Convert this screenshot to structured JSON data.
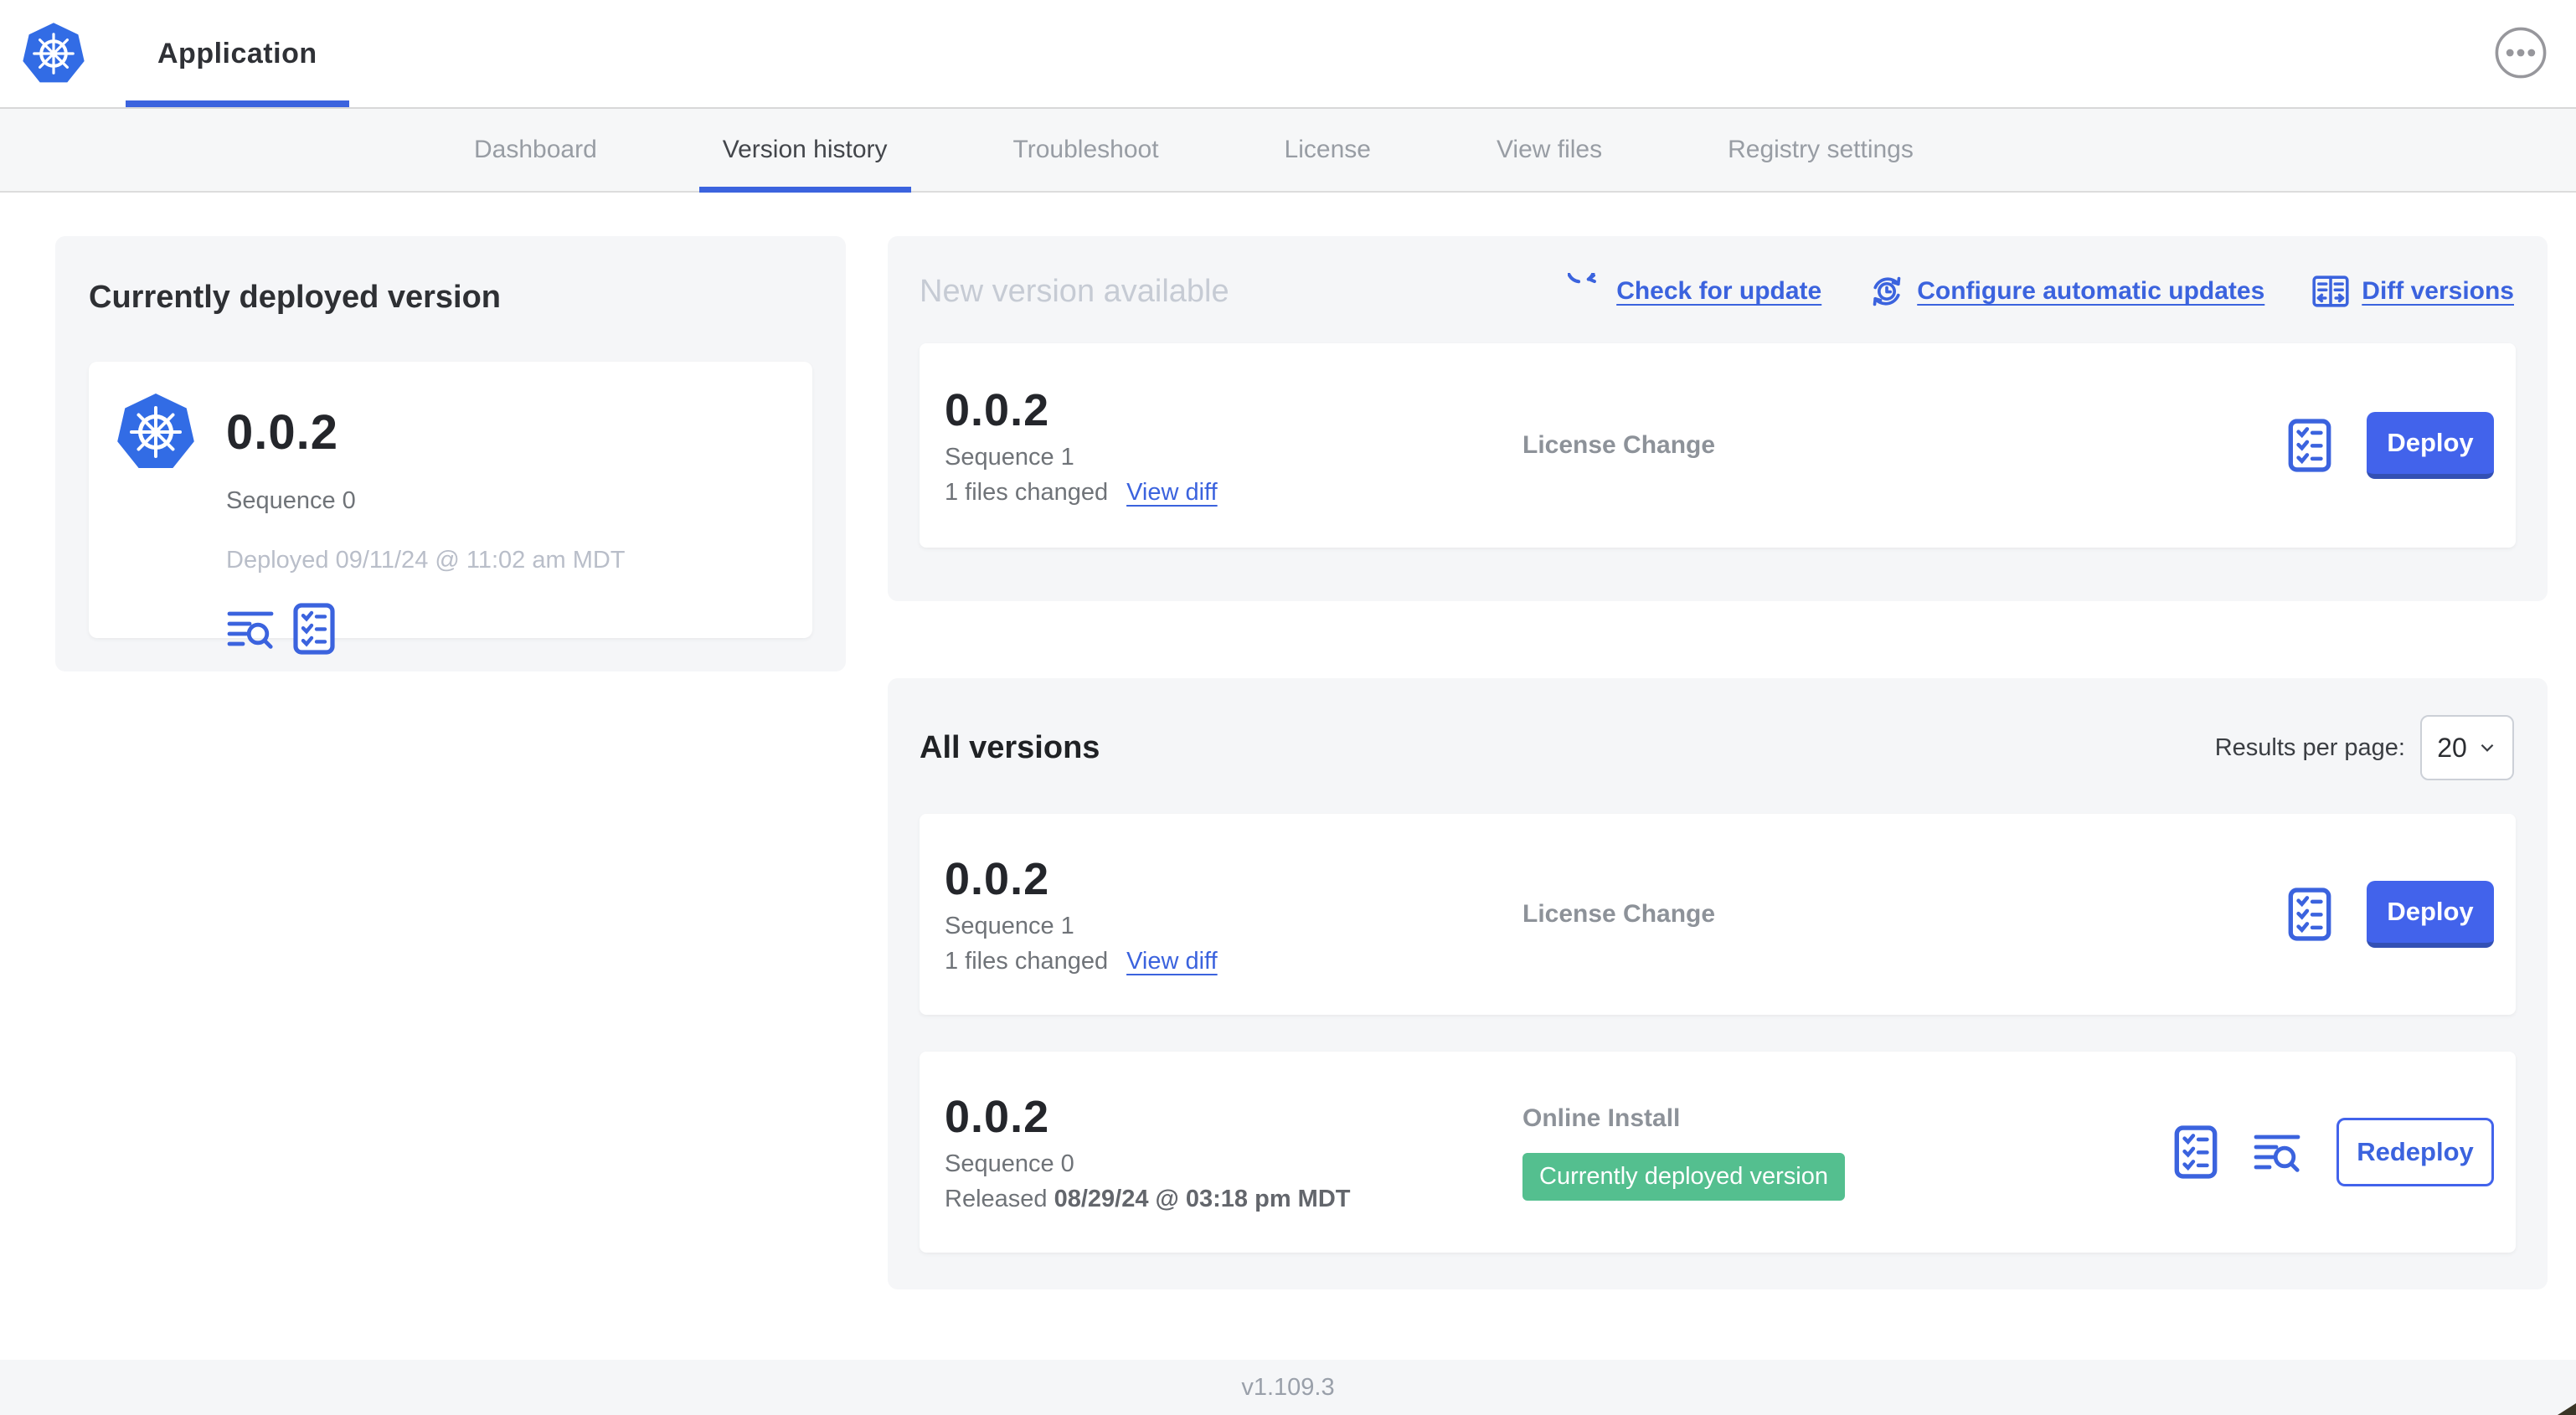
{
  "header": {
    "app_tab": "Application"
  },
  "nav": {
    "tabs": [
      {
        "label": "Dashboard",
        "active": false
      },
      {
        "label": "Version history",
        "active": true
      },
      {
        "label": "Troubleshoot",
        "active": false
      },
      {
        "label": "License",
        "active": false
      },
      {
        "label": "View files",
        "active": false
      },
      {
        "label": "Registry settings",
        "active": false
      }
    ]
  },
  "currently_deployed": {
    "title": "Currently deployed version",
    "version": "0.0.2",
    "sequence": "Sequence 0",
    "deployed": "Deployed 09/11/24 @ 11:02 am MDT"
  },
  "new_version": {
    "title": "New version available",
    "actions": {
      "check_for_update": "Check for update",
      "configure_automatic_updates": "Configure automatic updates",
      "diff_versions": "Diff versions"
    },
    "card": {
      "version": "0.0.2",
      "sequence": "Sequence 1",
      "files_changed": "1 files changed",
      "view_diff": "View diff",
      "source": "License Change",
      "action_label": "Deploy"
    }
  },
  "all_versions": {
    "title": "All versions",
    "results_per_page_label": "Results per page:",
    "results_per_page_value": "20",
    "rows": [
      {
        "version": "0.0.2",
        "sequence": "Sequence 1",
        "files_changed": "1 files changed",
        "view_diff": "View diff",
        "source": "License Change",
        "action_label": "Deploy"
      },
      {
        "version": "0.0.2",
        "sequence": "Sequence 0",
        "released_label": "Released",
        "released_date": "08/29/24 @ 03:18 pm MDT",
        "source": "Online Install",
        "badge": "Currently deployed version",
        "action_label": "Redeploy"
      }
    ]
  },
  "footer": {
    "version": "v1.109.3"
  },
  "icons": {
    "app_logo": "kubernetes-wheel",
    "more": "ellipsis-circle",
    "check_for_update": "refresh-arrow",
    "configure_automatic_updates": "clock-sync-arrows",
    "diff_versions": "split-compare",
    "release_notes": "checklist",
    "logs": "lines-magnifier",
    "results_select": "chevron-down"
  },
  "colors": {
    "accent_blue": "#4263eb",
    "link_blue": "#3b63de",
    "kubernetes_blue": "#326ce5",
    "badge_green": "#54bf8f",
    "panel_bg": "#f5f6f8"
  }
}
